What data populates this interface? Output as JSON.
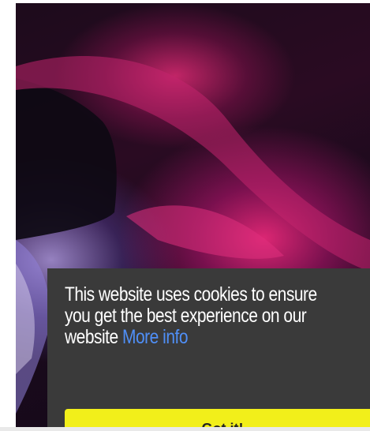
{
  "hero": {
    "image_name": "abstract-car-image"
  },
  "cookie_banner": {
    "line1": "This website uses cookies to ensure",
    "line2": "you get the best experience on our",
    "line3_prefix": "website ",
    "more_info_label": "More info",
    "accept_label": "Got it!",
    "background_color": "#3a3a3a",
    "link_color": "#4f8ff7",
    "button_color": "#f2ef1a"
  }
}
